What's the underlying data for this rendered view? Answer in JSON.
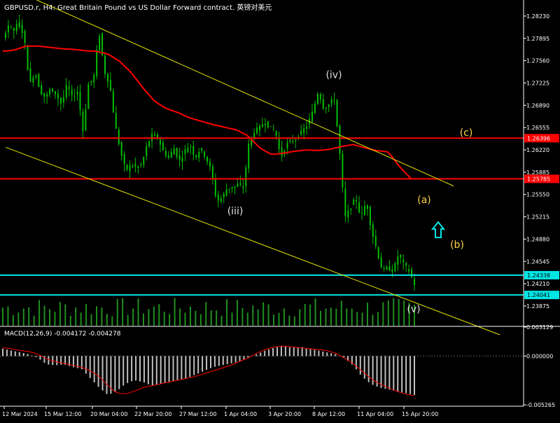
{
  "header": {
    "title": "GBPUSD.r, H4:  Great Britain Pound vs US Dollar Forward contract. 英镑对美元"
  },
  "colors": {
    "background": "#000000",
    "candle": "#00c000",
    "volume": "#1f8f1f",
    "ma": "#ff0000",
    "channel": "#e6e600",
    "level_red": "#ff0000",
    "level_cyan": "#00e5e5",
    "wave_white": "#e0e0e0",
    "wave_yellow": "#ffd24a",
    "arrow": "#00e5e5",
    "macd_hist": "#c0c0c0",
    "macd_signal": "#ff0000",
    "axis_text": "#ffffff"
  },
  "chart_data": [
    {
      "type": "candlestick",
      "symbol": "GBPUSD.r",
      "timeframe": "H4",
      "ylim": [
        1.2358,
        1.2845
      ],
      "y_ticks": [
        "1.28230",
        "1.27895",
        "1.27560",
        "1.27225",
        "1.26890",
        "1.26555",
        "1.26220",
        "1.25885",
        "1.25550",
        "1.25215",
        "1.24880",
        "1.24545",
        "1.24210",
        "1.23875"
      ],
      "x_ticks": [
        "12 Mar 2024",
        "15 Mar 12:00",
        "20 Mar 04:00",
        "22 Mar 20:00",
        "27 Mar 12:00",
        "1 Apr 04:00",
        "3 Apr 20:00",
        "8 Apr 12:00",
        "11 Apr 04:00",
        "15 Apr 20:00"
      ],
      "close_path": [
        1.279,
        1.281,
        1.28,
        1.2815,
        1.279,
        1.272,
        1.274,
        1.271,
        1.27,
        1.2715,
        1.2705,
        1.269,
        1.272,
        1.27,
        1.271,
        1.265,
        1.272,
        1.273,
        1.28,
        1.274,
        1.272,
        1.266,
        1.262,
        1.259,
        1.26,
        1.2595,
        1.26,
        1.263,
        1.2645,
        1.264,
        1.262,
        1.261,
        1.2625,
        1.2605,
        1.262,
        1.263,
        1.261,
        1.2625,
        1.261,
        1.259,
        1.2545,
        1.255,
        1.2565,
        1.2565,
        1.257,
        1.2565,
        1.263,
        1.265,
        1.2655,
        1.2665,
        1.2655,
        1.265,
        1.261,
        1.263,
        1.2635,
        1.264,
        1.265,
        1.266,
        1.268,
        1.271,
        1.2685,
        1.269,
        1.27,
        1.262,
        1.252,
        1.2535,
        1.255,
        1.252,
        1.2545,
        1.25,
        1.247,
        1.244,
        1.2445,
        1.244,
        1.2465,
        1.245,
        1.244,
        1.242
      ],
      "ma_path": [
        1.277,
        1.2772,
        1.2778,
        1.2778,
        1.2776,
        1.2774,
        1.2773,
        1.2771,
        1.277,
        1.2766,
        1.2755,
        1.2738,
        1.2715,
        1.2695,
        1.2684,
        1.2678,
        1.267,
        1.2665,
        1.266,
        1.2656,
        1.2652,
        1.2643,
        1.2625,
        1.2615,
        1.2617,
        1.262,
        1.2622,
        1.2621,
        1.2623,
        1.2627,
        1.263,
        1.2625,
        1.2621,
        1.2619,
        1.2596,
        1.2578
      ],
      "volume_max": 2000,
      "volume_samples": 80,
      "channel_upper": [
        [
          "12 Mar 2024",
          1.2868
        ],
        [
          "15 Apr 20:00",
          1.2594
        ]
      ],
      "channel_lower": [
        [
          "12 Mar 2024",
          1.2626
        ],
        [
          "15 Apr 20:00",
          1.2393
        ]
      ],
      "levels": [
        {
          "value": 1.26396,
          "label": "1.26396",
          "color": "#ff0000"
        },
        {
          "value": 1.25785,
          "label": "1.25785",
          "color": "#ff0000"
        },
        {
          "value": 1.24338,
          "label": "1.24338",
          "color": "#00e5e5"
        },
        {
          "value": 1.24041,
          "label": "1.24041",
          "color": "#00e5e5"
        }
      ],
      "wave_labels": [
        {
          "text": "(iii)",
          "x": "1 Apr 04:00",
          "y": 1.2525,
          "color": "#e0e0e0"
        },
        {
          "text": "(iv)",
          "x": "8 Apr 12:00",
          "y": 1.273,
          "color": "#e0e0e0"
        },
        {
          "text": "(v)",
          "x": "15 Apr 20:00",
          "y": 1.2378,
          "color": "#e0e0e0"
        },
        {
          "text": "(c)",
          "x": "after 15 Apr 20:00",
          "y": 1.2643,
          "color": "#ffd24a"
        },
        {
          "text": "(a)",
          "x": "after 15 Apr 20:00",
          "y": 1.2542,
          "color": "#ffd24a"
        },
        {
          "text": "(b)",
          "x": "after 15 Apr 20:00",
          "y": 1.2475,
          "color": "#ffd24a"
        }
      ],
      "arrow": {
        "direction": "up",
        "color": "#00e5e5",
        "y": 1.2503
      }
    },
    {
      "type": "bar",
      "indicator": "MACD(12,26,9)",
      "label": "MACD(12,26,9) -0.004172 -0.004278",
      "ylim": [
        -0.00526,
        0.00313
      ],
      "y_ticks": [
        "0.003129",
        "0.000000",
        "-0.005265"
      ],
      "histogram_path": [
        0.0008,
        0.0006,
        0.0004,
        0.0002,
        -0.0002,
        -0.0009,
        -0.001,
        -0.0009,
        -0.0012,
        -0.0014,
        -0.0024,
        -0.0034,
        -0.0042,
        -0.0038,
        -0.003,
        -0.0026,
        -0.0028,
        -0.0032,
        -0.003,
        -0.0028,
        -0.0026,
        -0.0024,
        -0.002,
        -0.0016,
        -0.0012,
        -0.001,
        -0.0008,
        -0.0006,
        -0.0002,
        0.0002,
        0.0006,
        0.0009,
        0.0011,
        0.0009,
        0.001,
        0.0008,
        0.0006,
        0.0004,
        0.0002,
        -0.0002,
        -0.001,
        -0.0022,
        -0.003,
        -0.0034,
        -0.0036,
        -0.0038,
        -0.004,
        -0.0042
      ],
      "signal_path": [
        0.0009,
        0.0008,
        0.0006,
        0.0005,
        0.0002,
        -0.0003,
        -0.0006,
        -0.0008,
        -0.001,
        -0.0012,
        -0.0016,
        -0.0022,
        -0.0032,
        -0.004,
        -0.0041,
        -0.0038,
        -0.0034,
        -0.0032,
        -0.003,
        -0.0028,
        -0.0026,
        -0.0024,
        -0.0022,
        -0.0019,
        -0.0016,
        -0.0013,
        -0.001,
        -0.0006,
        -0.0002,
        0.0003,
        0.0007,
        0.001,
        0.0011,
        0.001,
        0.0009,
        0.0008,
        0.0007,
        0.0006,
        0.0003,
        -0.0002,
        -0.0008,
        -0.0016,
        -0.0024,
        -0.003,
        -0.0034,
        -0.0038,
        -0.0041,
        -0.0043
      ]
    }
  ]
}
